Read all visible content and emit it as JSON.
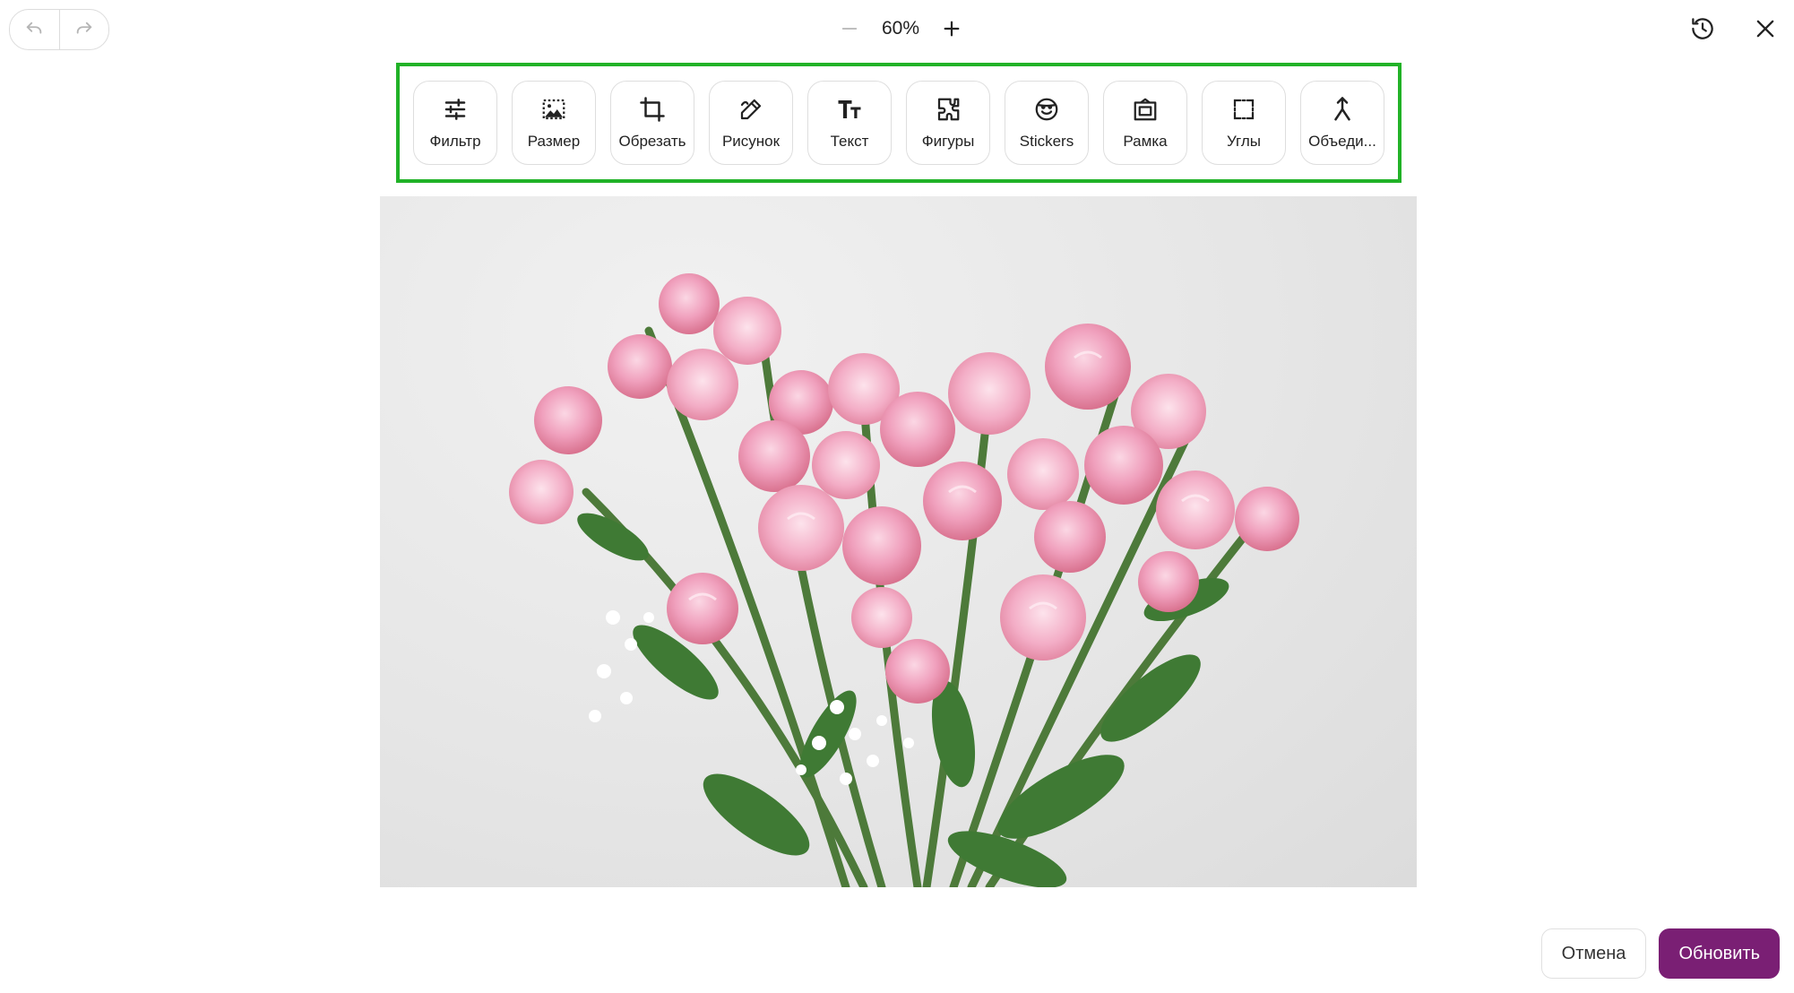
{
  "zoom": {
    "level": "60%"
  },
  "toolbar": {
    "tools": [
      {
        "label": "Фильтр",
        "icon": "sliders-icon"
      },
      {
        "label": "Размер",
        "icon": "resize-icon"
      },
      {
        "label": "Обрезать",
        "icon": "crop-icon"
      },
      {
        "label": "Рисунок",
        "icon": "draw-icon"
      },
      {
        "label": "Текст",
        "icon": "text-icon"
      },
      {
        "label": "Фигуры",
        "icon": "shapes-icon"
      },
      {
        "label": "Stickers",
        "icon": "sticker-icon"
      },
      {
        "label": "Рамка",
        "icon": "frame-icon"
      },
      {
        "label": "Углы",
        "icon": "corners-icon"
      },
      {
        "label": "Объеди...",
        "icon": "merge-icon"
      }
    ]
  },
  "actions": {
    "cancel_label": "Отмена",
    "update_label": "Обновить"
  },
  "colors": {
    "highlight": "#21b227",
    "primary": "#7a1f74"
  }
}
